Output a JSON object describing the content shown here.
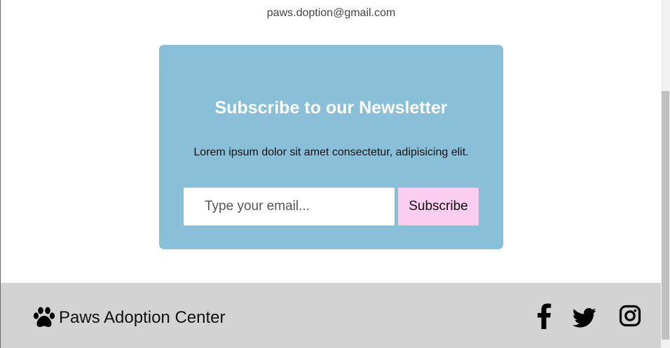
{
  "contact": {
    "email": "paws.doption@gmail.com"
  },
  "newsletter": {
    "title": "Subscribe to our Newsletter",
    "description": "Lorem ipsum dolor sit amet consectetur, adipisicing elit.",
    "email_placeholder": "Type your email...",
    "subscribe_label": "Subscribe"
  },
  "footer": {
    "brand_icon": "paw-icon",
    "brand_name": "Paws Adoption Center",
    "social": [
      {
        "icon": "facebook-icon"
      },
      {
        "icon": "twitter-icon"
      },
      {
        "icon": "instagram-icon"
      }
    ]
  },
  "colors": {
    "newsletter_bg": "#89c0d8",
    "subscribe_button_bg": "#fbcdf0",
    "footer_bg": "#d3d3d3",
    "title_text": "#ffffff"
  }
}
